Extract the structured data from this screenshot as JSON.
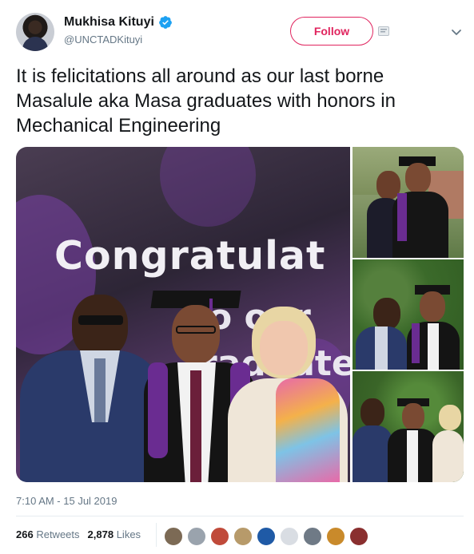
{
  "author": {
    "display_name": "Mukhisa Kituyi",
    "handle": "@UNCTADKituyi",
    "verified": true,
    "verified_icon": "verified-badge-icon",
    "verified_color": "#1da1f2"
  },
  "actions": {
    "follow_label": "Follow",
    "follow_color": "#e0245e",
    "more_icon": "chevron-down-icon"
  },
  "tweet": {
    "text": "It is felicitations all around as our last borne Masalule aka Masa graduates with honors in Mechanical Engineering",
    "timestamp": "7:10 AM - 15 Jul 2019"
  },
  "media": {
    "photo_count": 4,
    "banner_text_line1": "Congratulat",
    "banner_text_line2": "o our",
    "banner_text_line3": "raduate"
  },
  "stats": {
    "retweets_count": "266",
    "retweets_label": "Retweets",
    "likes_count": "2,878",
    "likes_label": "Likes",
    "liker_avatars": [
      {
        "color": "#7c6a55"
      },
      {
        "color": "#9aa3ad"
      },
      {
        "color": "#c04a3a"
      },
      {
        "color": "#b79a6a"
      },
      {
        "color": "#1f5aa6"
      },
      {
        "color": "#d9dde3"
      },
      {
        "color": "#6f7a86"
      },
      {
        "color": "#c98a2b"
      },
      {
        "color": "#8a2f2f"
      }
    ]
  }
}
